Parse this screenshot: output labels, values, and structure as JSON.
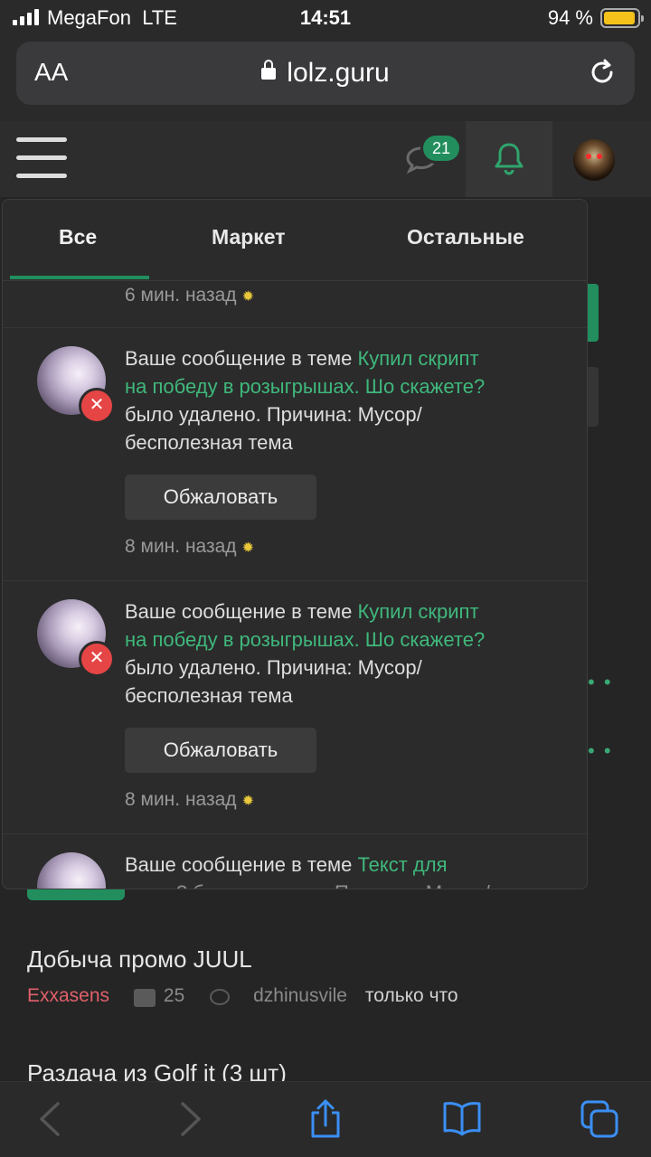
{
  "status_bar": {
    "carrier": "MegaFon",
    "network": "LTE",
    "time": "14:51",
    "battery": "94 %",
    "battery_level": 0.94
  },
  "address_bar": {
    "text_size": "AA",
    "url": "lolz.guru"
  },
  "header": {
    "messages_badge": "21"
  },
  "notifications_panel": {
    "tabs": [
      {
        "label": "Все"
      },
      {
        "label": "Маркет"
      },
      {
        "label": "Остальные"
      }
    ],
    "partial_time": "6 мин. назад",
    "items": [
      {
        "prefix": "Ваше сообщение в теме ",
        "thread_line1": "Купил скрипт",
        "thread_line2": "на победу в розыгрышах. Шо скажете?",
        "line3": "было удалено. Причина: Мусор/",
        "line4": "бесполезная тема",
        "button": "Обжаловать",
        "time": "8 мин. назад"
      },
      {
        "prefix": "Ваше сообщение в теме ",
        "thread_line1": "Купил скрипт",
        "thread_line2": "на победу в розыгрышах. Шо скажете?",
        "line3": "было удалено. Причина: Мусор/",
        "line4": "бесполезная тема",
        "button": "Обжаловать",
        "time": "8 мин. назад"
      },
      {
        "prefix": "Ваше сообщение в теме ",
        "thread_line1": "Текст для",
        "line2": "чиста? было удалено. Причина: Мусор/"
      }
    ]
  },
  "background_threads": [
    {
      "title": "Добыча промо JUUL",
      "author": "Exxasens",
      "replies": "25",
      "last_user": "dzhinusvile",
      "last_time": "только что"
    },
    {
      "title": "Раздача из Golf it (3 шт)"
    }
  ]
}
